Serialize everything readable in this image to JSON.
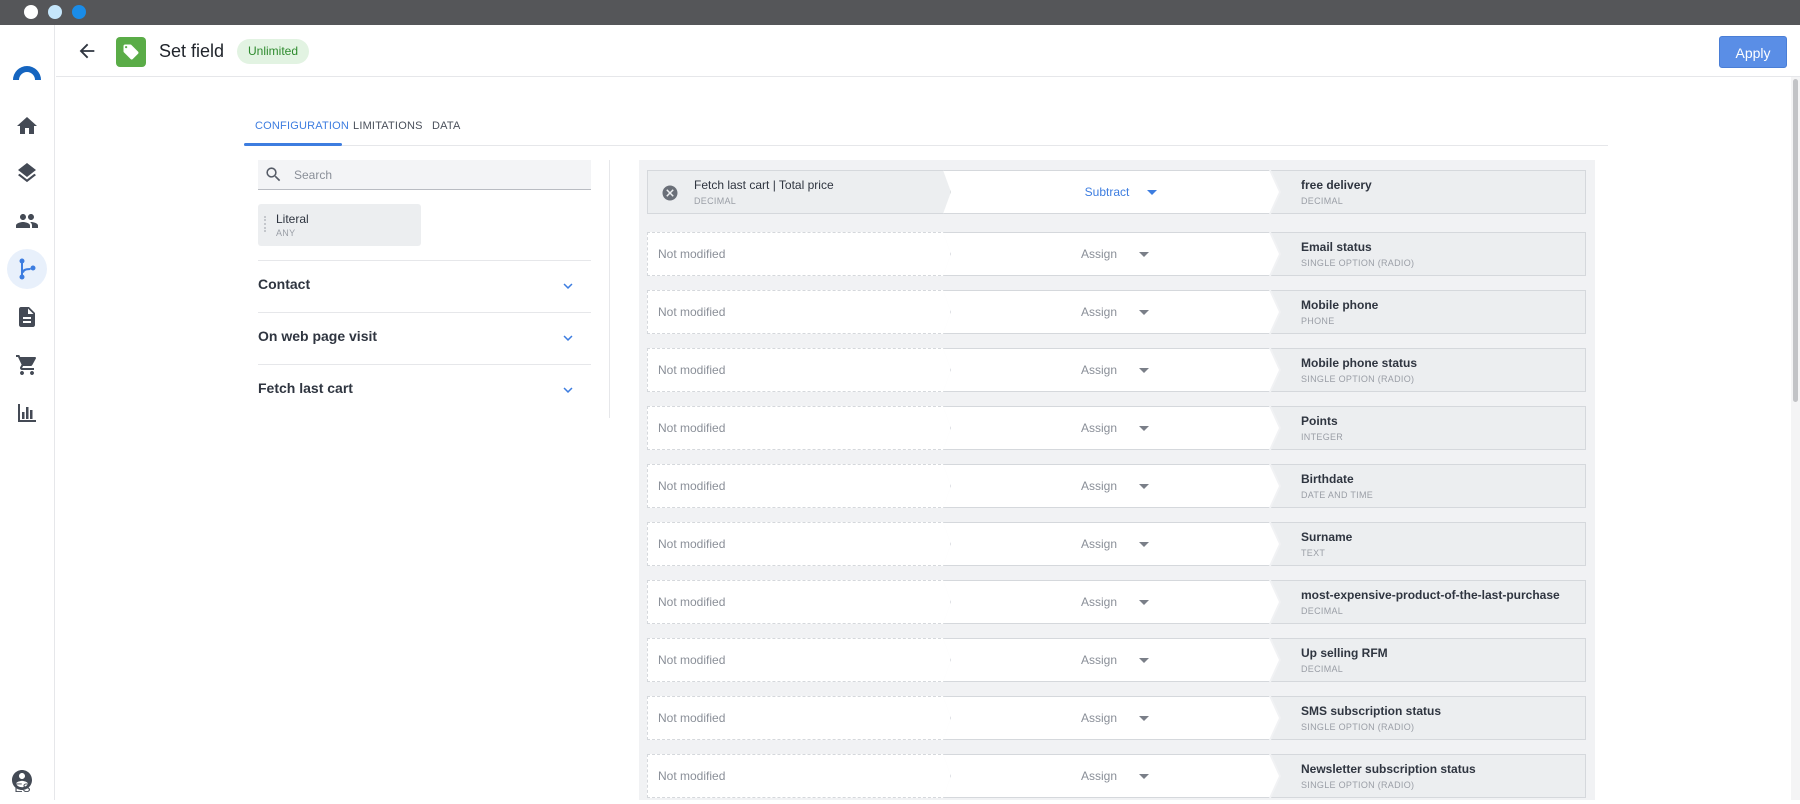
{
  "header": {
    "title": "Set field",
    "badge": "Unlimited",
    "apply_label": "Apply"
  },
  "sidebar": {
    "items": [
      {
        "icon": "home-icon"
      },
      {
        "icon": "layers-icon"
      },
      {
        "icon": "people-icon"
      },
      {
        "icon": "flow-icon",
        "active": true
      },
      {
        "icon": "document-icon"
      },
      {
        "icon": "cart-icon"
      },
      {
        "icon": "bar-chart-icon"
      }
    ],
    "language": "ES"
  },
  "tabs": [
    "CONFIGURATION",
    "LIMITATIONS",
    "DATA"
  ],
  "left": {
    "search_placeholder": "Search",
    "literal": {
      "label": "Literal",
      "type": "ANY"
    },
    "groups": [
      "Contact",
      "On web page visit",
      "Fetch last cart"
    ]
  },
  "rows": [
    {
      "source": "Fetch last cart | Total price",
      "source_type": "DECIMAL",
      "operation": "Subtract",
      "target": "free delivery",
      "target_type": "DECIMAL"
    },
    {
      "source": "Not modified",
      "operation": "Assign",
      "target": "Email status",
      "target_type": "SINGLE OPTION (RADIO)"
    },
    {
      "source": "Not modified",
      "operation": "Assign",
      "target": "Mobile phone",
      "target_type": "PHONE"
    },
    {
      "source": "Not modified",
      "operation": "Assign",
      "target": "Mobile phone status",
      "target_type": "SINGLE OPTION (RADIO)"
    },
    {
      "source": "Not modified",
      "operation": "Assign",
      "target": "Points",
      "target_type": "INTEGER"
    },
    {
      "source": "Not modified",
      "operation": "Assign",
      "target": "Birthdate",
      "target_type": "DATE AND TIME"
    },
    {
      "source": "Not modified",
      "operation": "Assign",
      "target": "Surname",
      "target_type": "TEXT"
    },
    {
      "source": "Not modified",
      "operation": "Assign",
      "target": "most-expensive-product-of-the-last-purchase",
      "target_type": "DECIMAL"
    },
    {
      "source": "Not modified",
      "operation": "Assign",
      "target": "Up selling RFM",
      "target_type": "DECIMAL"
    },
    {
      "source": "Not modified",
      "operation": "Assign",
      "target": "SMS subscription status",
      "target_type": "SINGLE OPTION (RADIO)"
    },
    {
      "source": "Not modified",
      "operation": "Assign",
      "target": "Newsletter subscription status",
      "target_type": "SINGLE OPTION (RADIO)"
    }
  ]
}
